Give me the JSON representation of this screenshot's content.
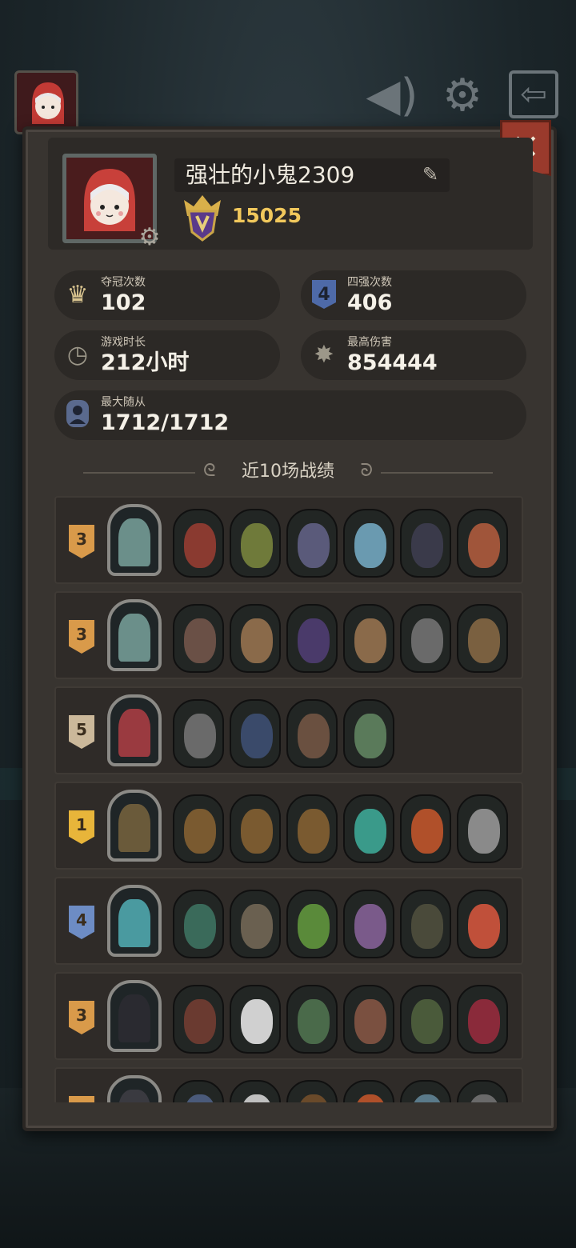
{
  "profile": {
    "name": "强壮的小鬼2309",
    "score": "15025"
  },
  "stats": [
    {
      "label": "夺冠次数",
      "value": "102",
      "icon": "crown-icon",
      "color": "#d9c48f"
    },
    {
      "label": "四强次数",
      "value": "406",
      "icon": "top4-badge-icon",
      "color": "#4e6aa8"
    },
    {
      "label": "游戏时长",
      "value": "212小时",
      "icon": "clock-icon",
      "color": "#9c9789"
    },
    {
      "label": "最高伤害",
      "value": "854444",
      "icon": "damage-burst-icon",
      "color": "#9c9789"
    },
    {
      "label": "最大随从",
      "value": "1712/1712",
      "icon": "minion-slot-icon",
      "color": "#5a6a8e"
    }
  ],
  "section_title": "近10场战绩",
  "matches": [
    {
      "place": "3",
      "hero_color": "#6b8f8a",
      "minions": [
        "#8a3a30",
        "#6f7a3a",
        "#5a5a7a",
        "#6a9ab0",
        "#3a3a4a",
        "#a0553a"
      ]
    },
    {
      "place": "3",
      "hero_color": "#6b8f8a",
      "minions": [
        "#6a5046",
        "#8a6a4a",
        "#4a3a6a",
        "#8a6a4a",
        "#6a6a6a",
        "#7a6040"
      ]
    },
    {
      "place": "5",
      "hero_color": "#9a3a40",
      "minions": [
        "#6a6a6a",
        "#3a4a6a",
        "#6a5040",
        "#5a7a5a"
      ]
    },
    {
      "place": "1",
      "hero_color": "#6a5a3a",
      "minions": [
        "#7a5a30",
        "#7a5a30",
        "#7a5a30",
        "#3a9a8a",
        "#b0502a",
        "#8a8a8a"
      ]
    },
    {
      "place": "4",
      "hero_color": "#4a9aa0",
      "minions": [
        "#3a6a5a",
        "#6a6050",
        "#5a8a3a",
        "#7a5a8a",
        "#4a4a3a",
        "#c0503a"
      ]
    },
    {
      "place": "3",
      "hero_color": "#2a2a30",
      "minions": [
        "#6a3a30",
        "#d0d0d0",
        "#4a6a4a",
        "#7a5040",
        "#4a5a3a",
        "#8a2a3a"
      ]
    },
    {
      "place": "",
      "hero_color": "#3a3a40",
      "minions": [
        "#4a5a7a",
        "#c0c0c0",
        "#6a4a2a",
        "#b0502a",
        "#5a7a8a",
        "#6a6a6a"
      ]
    }
  ],
  "colors": {
    "place_gold": "#d99a4a",
    "place_first": "#e8b53a",
    "place_four": "#6d8cc4",
    "place_five": "#cbb89a"
  }
}
